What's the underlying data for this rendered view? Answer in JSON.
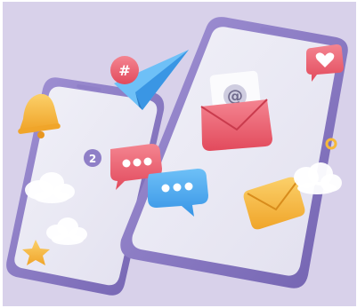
{
  "scene": {
    "description_free": true,
    "colors": {
      "background": "#d8d1ea",
      "phone_frame": "#8f7fc7",
      "phone_frame_dark": "#7464b2",
      "phone_screen": "#ececf6",
      "accent_red": "#ef5b6b",
      "accent_blue": "#4aa7f0",
      "accent_yellow": "#f6b93a",
      "cloud": "#ffffff"
    },
    "icons": [
      "smartphone-back",
      "smartphone-front",
      "envelope-at-icon",
      "paper-plane-icon",
      "hashtag-badge-icon",
      "heart-badge-icon",
      "bell-icon",
      "chat-bubble-red-icon",
      "chat-bubble-blue-icon",
      "mail-envelope-icon",
      "star-icon",
      "cloud-icon"
    ],
    "glyphs": {
      "at_symbol": "@",
      "hashtag": "#",
      "badge_count": "2"
    }
  }
}
